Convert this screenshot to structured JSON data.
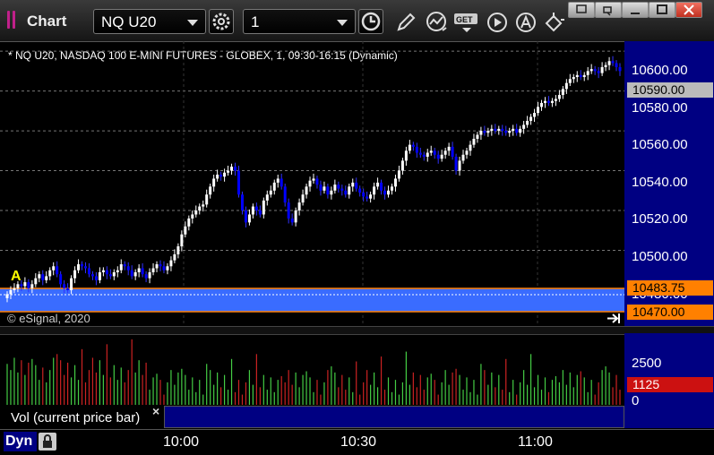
{
  "window": {
    "title": "Chart",
    "symbol": "NQ U20",
    "interval": "1"
  },
  "chart": {
    "subtitle": "* NQ U20, NASDAQ 100 E-MINI FUTURES - GLOBEX, 1, 09:30-16:15 (Dynamic)",
    "copyright": "© eSignal, 2020",
    "marker_label": "A",
    "price_labels": [
      "10600.00",
      "10580.00",
      "10560.00",
      "10540.00",
      "10520.00",
      "10500.00",
      "10480.00"
    ],
    "last_price": "10590.00",
    "upper_level": "10483.75",
    "lower_level": "10470.00",
    "colors": {
      "up": "#ffffff",
      "down": "#0000ff",
      "level": "#ff8000",
      "zone": "#3a6cff",
      "axis_bg": "#000082"
    }
  },
  "volume": {
    "label": "Vol (current price bar)",
    "close_glyph": "×",
    "scale_labels": [
      "2500",
      "0"
    ],
    "current": "1125",
    "colors": {
      "up": "#44cc44",
      "down": "#cc2222"
    }
  },
  "time_axis": {
    "mode": "Dyn",
    "labels": [
      "10:00",
      "10:30",
      "11:00"
    ]
  },
  "chart_data": {
    "type": "candlestick",
    "interval_minutes": 1,
    "y_unit": "price",
    "ylim": [
      10462,
      10605
    ],
    "last": 10590.0,
    "levels": [
      10483.75,
      10470.0
    ],
    "closes": [
      10478,
      10480,
      10481,
      10483,
      10482,
      10484,
      10481,
      10483,
      10486,
      10488,
      10485,
      10487,
      10490,
      10492,
      10488,
      10483,
      10481,
      10480,
      10486,
      10490,
      10493,
      10492,
      10491,
      10488,
      10487,
      10485,
      10489,
      10490,
      10488,
      10487,
      10489,
      10490,
      10493,
      10492,
      10490,
      10487,
      10489,
      10491,
      10488,
      10486,
      10489,
      10491,
      10493,
      10492,
      10490,
      10492,
      10495,
      10498,
      10502,
      10508,
      10512,
      10516,
      10518,
      10520,
      10522,
      10523,
      10528,
      10532,
      10536,
      10538,
      10537,
      10539,
      10540,
      10542,
      10540,
      10528,
      10520,
      10514,
      10518,
      10522,
      10520,
      10518,
      10525,
      10528,
      10530,
      10534,
      10536,
      10532,
      10524,
      10516,
      10514,
      10520,
      10524,
      10528,
      10532,
      10535,
      10536,
      10533,
      10530,
      10532,
      10528,
      10530,
      10533,
      10531,
      10530,
      10528,
      10532,
      10534,
      10531,
      10529,
      10527,
      10526,
      10528,
      10532,
      10534,
      10530,
      10528,
      10530,
      10532,
      10536,
      10540,
      10545,
      10550,
      10553,
      10552,
      10549,
      10548,
      10547,
      10549,
      10550,
      10548,
      10546,
      10548,
      10550,
      10552,
      10547,
      10540,
      10545,
      10548,
      10550,
      10553,
      10556,
      10558,
      10560,
      10559,
      10560,
      10561,
      10560,
      10561,
      10560,
      10559,
      10560,
      10561,
      10559,
      10561,
      10563,
      10565,
      10567,
      10569,
      10572,
      10574,
      10575,
      10574,
      10575,
      10576,
      10578,
      10581,
      10584,
      10586,
      10587,
      10588,
      10587,
      10588,
      10590,
      10591,
      10590,
      10589,
      10592,
      10593,
      10595,
      10594,
      10592,
      10590
    ],
    "volume_ylim": [
      0,
      3500
    ]
  }
}
